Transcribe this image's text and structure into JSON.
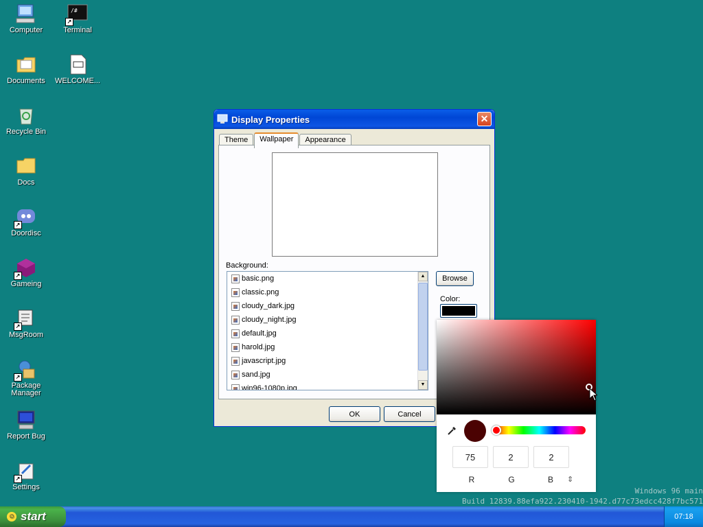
{
  "desktop": {
    "icons": [
      {
        "label": "Computer"
      },
      {
        "label": "Terminal"
      },
      {
        "label": "Documents"
      },
      {
        "label": "WELCOME..."
      },
      {
        "label": "Recycle Bin"
      },
      {
        "label": "Docs"
      },
      {
        "label": "Doordisc"
      },
      {
        "label": "Gameing"
      },
      {
        "label": "MsgRoom"
      },
      {
        "label": "Package Manager"
      },
      {
        "label": "Report Bug"
      },
      {
        "label": "Settings"
      }
    ]
  },
  "window": {
    "title": "Display Properties",
    "close_glyph": "✕",
    "tabs": [
      "Theme",
      "Wallpaper",
      "Appearance"
    ],
    "active_tab": "Wallpaper",
    "background_label": "Background:",
    "files": [
      "basic.png",
      "classic.png",
      "cloudy_dark.jpg",
      "cloudy_night.jpg",
      "default.jpg",
      "harold.jpg",
      "javascript.jpg",
      "sand.jpg",
      "win96-1080p.jpg"
    ],
    "browse_label": "Browse",
    "color_label": "Color:",
    "ok_label": "OK",
    "cancel_label": "Cancel"
  },
  "color_picker": {
    "preview_color": "#4b0202",
    "r": "75",
    "g": "2",
    "b": "2",
    "r_label": "R",
    "g_label": "G",
    "b_label": "B",
    "mode_toggle": "⇕"
  },
  "watermark": {
    "line1": "Windows 96 main",
    "line2": "Build 12839.88efa922.230410-1942.d77c73edcc428f7bc571"
  },
  "taskbar": {
    "start_label": "start",
    "clock": "07:18"
  }
}
